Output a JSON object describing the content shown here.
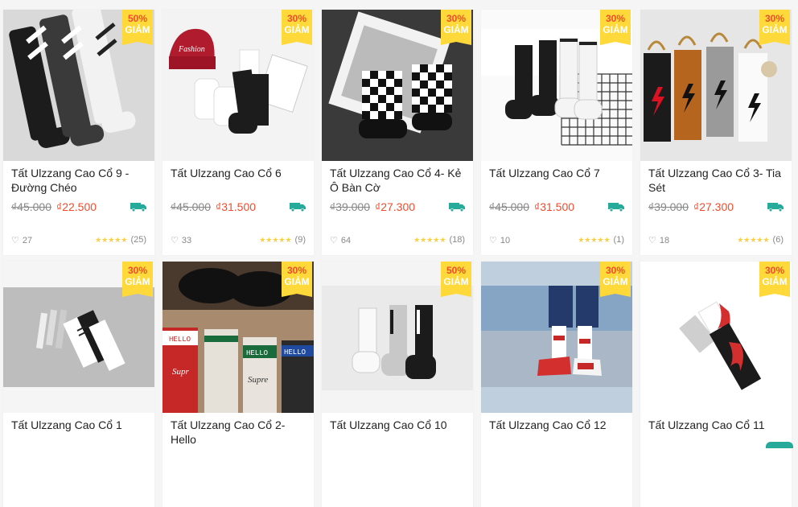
{
  "badge_giam": "GIẢM",
  "products": [
    {
      "name": "Tất Ulzzang Cao Cổ 9 - Đường Chéo",
      "discount": "50%",
      "old_price": "₫45.000",
      "price": "₫22.500",
      "likes": "27",
      "reviews": "(25)",
      "img": "diagonal"
    },
    {
      "name": "Tất Ulzzang Cao Cổ 6",
      "discount": "30%",
      "old_price": "₫45.000",
      "price": "₫31.500",
      "likes": "33",
      "reviews": "(9)",
      "img": "beanie"
    },
    {
      "name": "Tất Ulzzang Cao Cổ 4- Kẻ Ô Bàn Cờ",
      "discount": "30%",
      "old_price": "₫39.000",
      "price": "₫27.300",
      "likes": "64",
      "reviews": "(18)",
      "img": "checker"
    },
    {
      "name": "Tất Ulzzang Cao Cổ 7",
      "discount": "30%",
      "old_price": "₫45.000",
      "price": "₫31.500",
      "likes": "10",
      "reviews": "(1)",
      "img": "butterfly"
    },
    {
      "name": "Tất Ulzzang Cao Cổ 3- Tia Sét",
      "discount": "30%",
      "old_price": "₫39.000",
      "price": "₫27.300",
      "likes": "18",
      "reviews": "(6)",
      "img": "lightning"
    },
    {
      "name": "Tất Ulzzang Cao Cổ 1",
      "discount": "30%",
      "img": "pens"
    },
    {
      "name": "Tất Ulzzang Cao Cổ 2- Hello",
      "discount": "30%",
      "img": "hello"
    },
    {
      "name": "Tất Ulzzang Cao Cổ 10",
      "discount": "50%",
      "img": "three"
    },
    {
      "name": "Tất Ulzzang Cao Cổ 12",
      "discount": "30%",
      "img": "legs"
    },
    {
      "name": "Tất Ulzzang Cao Cổ 11",
      "discount": "30%",
      "img": "flame"
    }
  ],
  "colors": {
    "accent": "#ee4d2d",
    "badge": "#ffd839",
    "star": "#ffce3d",
    "freeship": "#26aa99"
  },
  "icons": {
    "like": "heart-icon",
    "shipping": "freeship-icon",
    "rating": "star-icon"
  }
}
